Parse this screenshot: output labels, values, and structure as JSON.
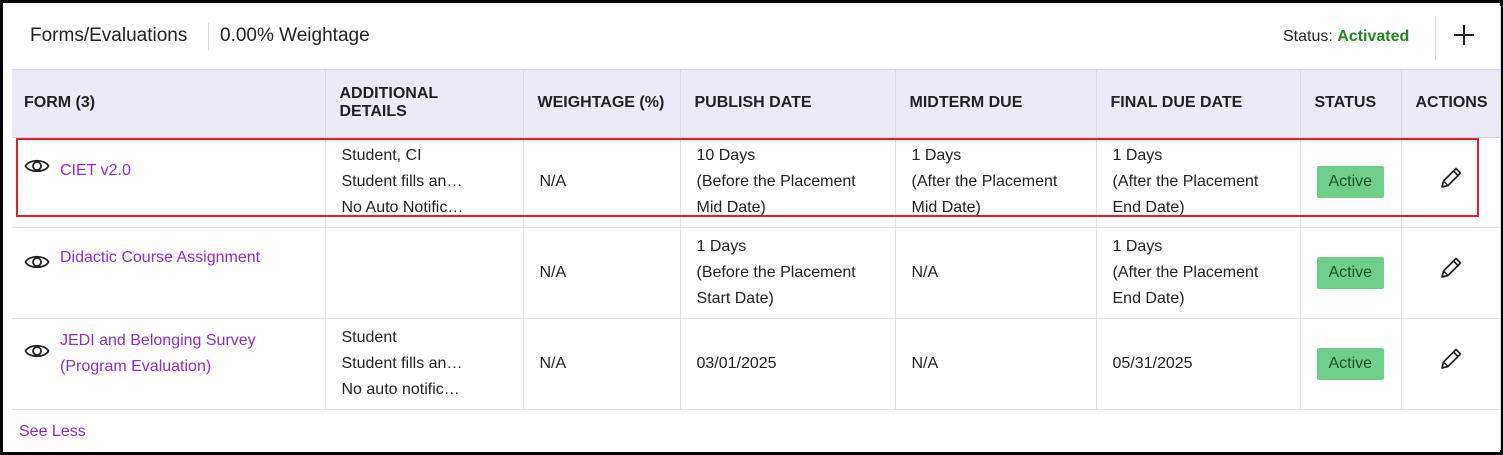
{
  "header": {
    "title": "Forms/Evaluations",
    "weightage": "0.00% Weightage",
    "status_label": "Status:",
    "status_value": "Activated",
    "status_color": "#1e8a1e",
    "add_icon": "plus-icon"
  },
  "table": {
    "columns": [
      "FORM (3)",
      "ADDITIONAL DETAILS",
      "WEIGHTAGE (%)",
      "PUBLISH DATE",
      "MIDTERM DUE",
      "FINAL DUE DATE",
      "STATUS",
      "ACTIONS"
    ],
    "rows": [
      {
        "form": "CIET v2.0",
        "details": [
          "Student, CI",
          "Student fills an…",
          "No Auto Notific…"
        ],
        "weightage": "N/A",
        "publish": [
          "10 Days",
          "(Before the Placement",
          "Mid Date)"
        ],
        "midterm": [
          "1 Days",
          "(After the Placement",
          "Mid Date)"
        ],
        "final": [
          "1 Days",
          "(After the Placement",
          "End Date)"
        ],
        "status": "Active"
      },
      {
        "form": "Didactic Course Assignment",
        "details": [
          "",
          "",
          ""
        ],
        "weightage": "N/A",
        "publish": [
          "1 Days",
          "(Before the Placement",
          "Start Date)"
        ],
        "midterm": [
          "N/A"
        ],
        "final": [
          "1 Days",
          "(After the Placement",
          "End Date)"
        ],
        "status": "Active"
      },
      {
        "form": "JEDI and Belonging Survey (Program Evaluation)",
        "details": [
          "Student",
          "Student fills an…",
          "No auto notific…"
        ],
        "weightage": "N/A",
        "publish": [
          "03/01/2025"
        ],
        "midterm": [
          "N/A"
        ],
        "final": [
          "05/31/2025"
        ],
        "status": "Active"
      }
    ]
  },
  "footer": {
    "see_less": "See Less"
  },
  "colors": {
    "link": "#8a2be2",
    "badge_bg": "#6fcf8a",
    "header_bg": "#ebebf8",
    "highlight": "#e0202a"
  }
}
